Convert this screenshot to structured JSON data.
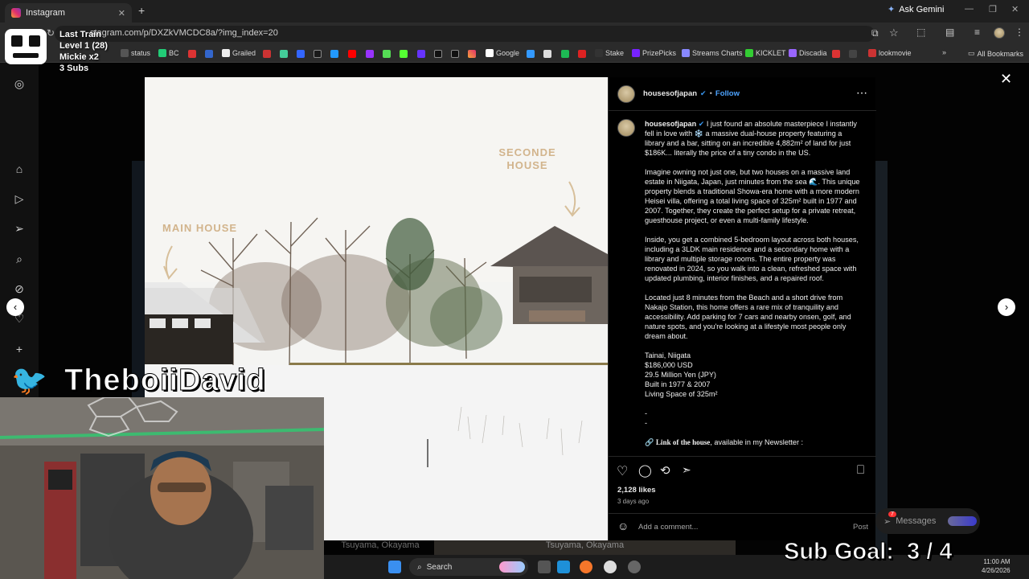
{
  "browser": {
    "tab_title": "Instagram",
    "url": "stagram.com/p/DXZkVMCDC8a/?img_index=20",
    "ask_gemini": "Ask Gemini",
    "bookmarks": [
      "status",
      "BC",
      "Grailed",
      "Google",
      "Stake",
      "PrizePicks",
      "Streams Charts",
      "KICKLET",
      "Discadia",
      "lookmovie"
    ],
    "all_bookmarks": "All Bookmarks"
  },
  "stream_overlay": {
    "train_title": "Last Train",
    "level": "Level 1  (28)",
    "mickie": "Mickie x2",
    "subs": "3 Subs",
    "twitter_name": "TheboiiDavid",
    "sub_goal": "Sub Goal:  3 / 4"
  },
  "photo": {
    "label_second": "SECONDE\nHOUSE",
    "label_main": "MAIN HOUSE"
  },
  "post": {
    "username": "housesofjapan",
    "follow": "Follow",
    "caption_p1": "I just found an absolute masterpiece I instantly fell in love with ❄️ a massive dual-house property featuring a library and a bar, sitting on an incredible 4,882m² of land for just $186K... literally the price of a tiny condo in the US.",
    "caption_p2": "Imagine owning not just one, but two houses on a massive land estate in Niigata, Japan, just minutes from the sea 🌊. This unique property blends a traditional Showa-era home with a more modern Heisei villa, offering a total living space of 325m² built in 1977 and 2007. Together, they create the perfect setup for a private retreat, guesthouse project, or even a multi-family lifestyle.",
    "caption_p3": "Inside, you get a combined 5-bedroom layout across both houses, including a 3LDK main residence and a secondary home with a library and multiple storage rooms. The entire property was renovated in 2024, so you walk into a clean, refreshed space with updated plumbing, interior finishes, and a repaired roof.",
    "caption_p4": "Located just 8 minutes from the Beach and a short drive from Nakajo Station, this home offers a rare mix of tranquility and accessibility. Add parking for 7 cars and nearby onsen, golf, and nature spots, and you're looking at a lifestyle most people only dream about.",
    "facts": [
      "Tainai, Niigata",
      "$186,000 USD",
      "29.5 Million Yen (JPY)",
      "Built in 1977 & 2007",
      "Living Space of 325m²"
    ],
    "dash1": "-",
    "dash2": "-",
    "link_bold": "Link of the house",
    "link_rest": ", available in my Newsletter :",
    "likes": "2,128 likes",
    "time_ago": "3 days ago",
    "comment_placeholder": "Add a comment...",
    "post_btn": "Post"
  },
  "messages": {
    "label": "Messages",
    "badge": "7"
  },
  "background_labels": [
    "Tsuyama, Okayama",
    "Tsuyama, Okayama"
  ],
  "taskbar": {
    "search": "Search",
    "time": "11:00 AM",
    "date": "4/26/2026"
  }
}
